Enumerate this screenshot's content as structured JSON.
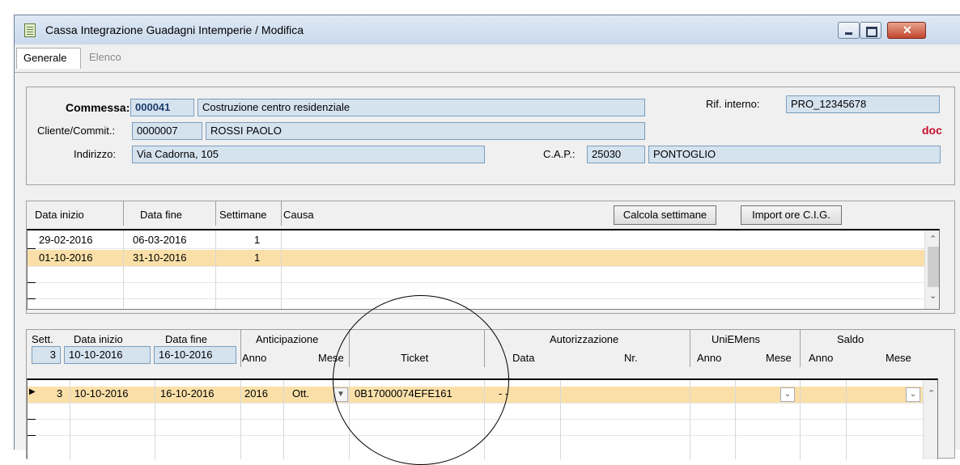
{
  "window": {
    "title": "Cassa Integrazione Guadagni Intemperie / Modifica"
  },
  "tabs": [
    {
      "label": "Generale"
    },
    {
      "label": "Elenco"
    }
  ],
  "header": {
    "commessa_label": "Commessa:",
    "commessa_code": "000041",
    "commessa_desc": "Costruzione centro residenziale",
    "rif_label": "Rif. interno:",
    "rif_value": "PRO_12345678",
    "cliente_label": "Cliente/Commit.:",
    "cliente_code": "0000007",
    "cliente_name": "ROSSI PAOLO",
    "doc_link": "doc",
    "indirizzo_label": "Indirizzo:",
    "indirizzo_value": "Via Cadorna, 105",
    "cap_label": "C.A.P.:",
    "cap_value": "25030",
    "citta_value": "PONTOGLIO"
  },
  "periods": {
    "columns": [
      "Data inizio",
      "Data fine",
      "Settimane",
      "Causa"
    ],
    "calc_button": "Calcola settimane",
    "import_button": "Import ore C.I.G.",
    "rows": [
      {
        "start": "29-02-2016",
        "end": "06-03-2016",
        "weeks": "1",
        "cause": ""
      },
      {
        "start": "01-10-2016",
        "end": "31-10-2016",
        "weeks": "1",
        "cause": ""
      }
    ]
  },
  "weeks": {
    "h_sett": "Sett.",
    "h_data_inizio": "Data inizio",
    "h_data_fine": "Data fine",
    "h_anticipazione": "Anticipazione",
    "h_anno": "Anno",
    "h_mese": "Mese",
    "h_ticket": "Ticket",
    "h_autorizzazione": "Autorizzazione",
    "h_data": "Data",
    "h_nr": "Nr.",
    "h_uniemens": "UniEMens",
    "h_uni_anno": "Anno",
    "h_uni_mese": "Mese",
    "h_saldo": "Saldo",
    "h_saldo_anno": "Anno",
    "h_saldo_mese": "Mese",
    "current_sett": "3",
    "current_start": "10-10-2016",
    "current_end": "16-10-2016",
    "rows": [
      {
        "sett": "3",
        "start": "10-10-2016",
        "end": "16-10-2016",
        "anno": "2016",
        "mese": "Ott.",
        "ticket": "0B17000074EFE161",
        "data": "- -",
        "nr": ""
      }
    ]
  }
}
